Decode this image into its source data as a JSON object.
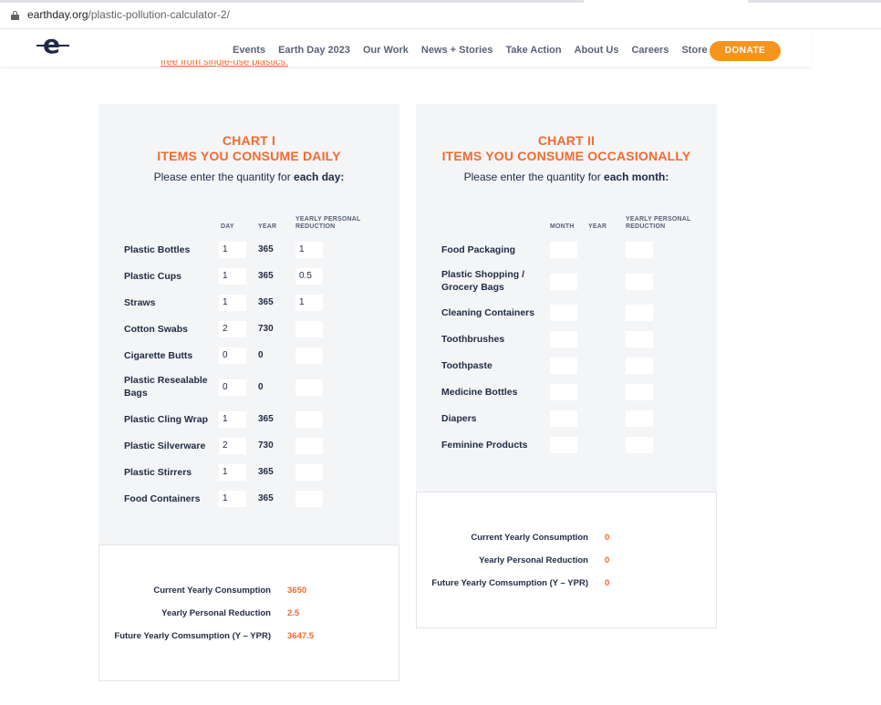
{
  "browser": {
    "url_host": "earthday.org",
    "url_path": "/plastic-pollution-calculator-2/"
  },
  "nav": {
    "logo": "e",
    "links": [
      "Events",
      "Earth Day 2023",
      "Our Work",
      "News + Stories",
      "Take Action",
      "About Us",
      "Careers",
      "Store"
    ],
    "donate": "DONATE"
  },
  "page": {
    "cutoff_link": "free from single-use plastics."
  },
  "chart1": {
    "title_line1": "CHART I",
    "title_line2": "ITEMS YOU CONSUME DAILY",
    "subtitle_pre": "Please enter the quantity for ",
    "subtitle_bold": "each day:",
    "col_day": "DAY",
    "col_year": "YEAR",
    "col_reduction": "YEARLY PERSONAL REDUCTION",
    "rows": [
      {
        "label": "Plastic Bottles",
        "day": "1",
        "year": "365",
        "reduction": "1"
      },
      {
        "label": "Plastic Cups",
        "day": "1",
        "year": "365",
        "reduction": "0.5"
      },
      {
        "label": "Straws",
        "day": "1",
        "year": "365",
        "reduction": "1"
      },
      {
        "label": "Cotton Swabs",
        "day": "2",
        "year": "730",
        "reduction": ""
      },
      {
        "label": "Cigarette Butts",
        "day": "0",
        "year": "0",
        "reduction": ""
      },
      {
        "label": "Plastic Resealable Bags",
        "day": "0",
        "year": "0",
        "reduction": ""
      },
      {
        "label": "Plastic Cling Wrap",
        "day": "1",
        "year": "365",
        "reduction": ""
      },
      {
        "label": "Plastic Silverware",
        "day": "2",
        "year": "730",
        "reduction": ""
      },
      {
        "label": "Plastic Stirrers",
        "day": "1",
        "year": "365",
        "reduction": ""
      },
      {
        "label": "Food Containers",
        "day": "1",
        "year": "365",
        "reduction": ""
      }
    ],
    "totals": {
      "current_label": "Current Yearly Consumption",
      "current_value": "3650",
      "reduction_label": "Yearly Personal Reduction",
      "reduction_value": "2.5",
      "future_label": "Future Yearly Comsumption (Y – YPR)",
      "future_value": "3647.5"
    }
  },
  "chart2": {
    "title_line1": "CHART II",
    "title_line2": "ITEMS YOU CONSUME OCCASIONALLY",
    "subtitle_pre": "Please enter the quantity for ",
    "subtitle_bold": "each month:",
    "col_month": "MONTH",
    "col_year": "YEAR",
    "col_reduction": "YEARLY PERSONAL REDUCTION",
    "rows": [
      {
        "label": "Food Packaging",
        "month": "",
        "year": "",
        "reduction": ""
      },
      {
        "label": "Plastic Shopping / Grocery Bags",
        "month": "",
        "year": "",
        "reduction": ""
      },
      {
        "label": "Cleaning Containers",
        "month": "",
        "year": "",
        "reduction": ""
      },
      {
        "label": "Toothbrushes",
        "month": "",
        "year": "",
        "reduction": ""
      },
      {
        "label": "Toothpaste",
        "month": "",
        "year": "",
        "reduction": ""
      },
      {
        "label": "Medicine Bottles",
        "month": "",
        "year": "",
        "reduction": ""
      },
      {
        "label": "Diapers",
        "month": "",
        "year": "",
        "reduction": ""
      },
      {
        "label": "Feminine Products",
        "month": "",
        "year": "",
        "reduction": ""
      }
    ],
    "totals": {
      "current_label": "Current Yearly Consumption",
      "current_value": "0",
      "reduction_label": "Yearly Personal Reduction",
      "reduction_value": "0",
      "future_label": "Future Yearly Comsumption (Y – YPR)",
      "future_value": "0"
    }
  }
}
